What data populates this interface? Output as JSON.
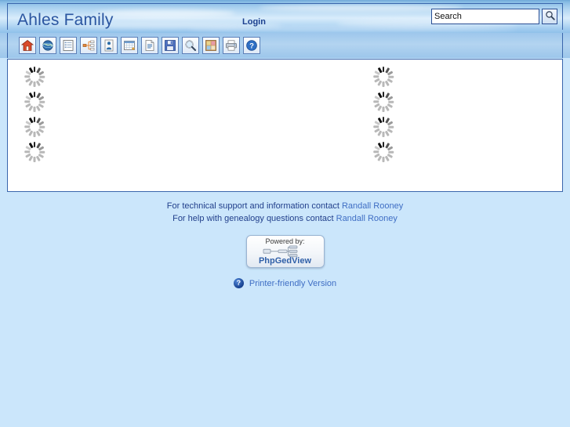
{
  "header": {
    "site_title": "Ahles Family",
    "login_label": "Login",
    "search": {
      "value": "Search",
      "placeholder": "Search",
      "button_icon": "search-icon"
    }
  },
  "toolbar": {
    "buttons": [
      {
        "name": "home-icon",
        "title": "Home page"
      },
      {
        "name": "globe-icon",
        "title": "My page"
      },
      {
        "name": "list-icon",
        "title": "Individual list"
      },
      {
        "name": "pedigree-icon",
        "title": "Pedigree tree"
      },
      {
        "name": "person-icon",
        "title": "Individual info"
      },
      {
        "name": "calendar-icon",
        "title": "Calendar"
      },
      {
        "name": "document-icon",
        "title": "Reports"
      },
      {
        "name": "save-icon",
        "title": "Clippings cart"
      },
      {
        "name": "magnifier-icon",
        "title": "Search"
      },
      {
        "name": "media-icon",
        "title": "Media"
      },
      {
        "name": "printer-icon",
        "title": "Print"
      },
      {
        "name": "help-icon",
        "title": "Help"
      }
    ]
  },
  "content": {
    "left_column_spinners": 4,
    "right_column_spinners": 4,
    "loading_label": "loading"
  },
  "footer": {
    "support_line_prefix": "For technical support and information contact ",
    "support_contact": "Randall Rooney",
    "genealogy_line_prefix": "For help with genealogy questions contact ",
    "genealogy_contact": "Randall Rooney",
    "logo": {
      "powered_by": "Powered by:",
      "product": "PhpGedView"
    },
    "printer_link": {
      "icon": "help-icon",
      "icon_glyph": "?",
      "label": "Printer-friendly Version"
    }
  },
  "colors": {
    "page_background": "#cbe6fb",
    "panel_background": "#ffffff",
    "border": "#3a66ac",
    "title_text": "#2a55a0",
    "body_text": "#22408c",
    "link": "#3f6ec4"
  }
}
